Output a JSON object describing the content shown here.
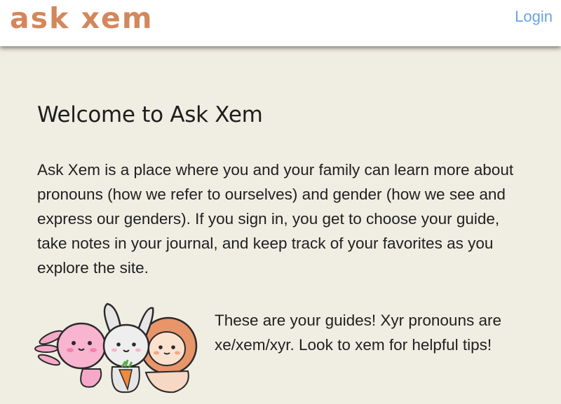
{
  "header": {
    "logo_text": "ask xem",
    "login_label": "Login"
  },
  "main": {
    "title": "Welcome to Ask Xem",
    "intro": "Ask Xem is a place where you and your family can learn more about pronouns (how we refer to ourselves) and gender (how we see and express our genders). If you sign in, you get to choose your guide, take notes in your journal, and keep track of your favorites as you explore the site.",
    "guides_text": "These are your guides! Xyr pronouns are xe/xem/xyr. Look to xem for helpful tips!"
  },
  "colors": {
    "background": "#f0ede2",
    "logo": "#d4875a",
    "link": "#6aa3e6",
    "text": "#1f1f1f"
  }
}
